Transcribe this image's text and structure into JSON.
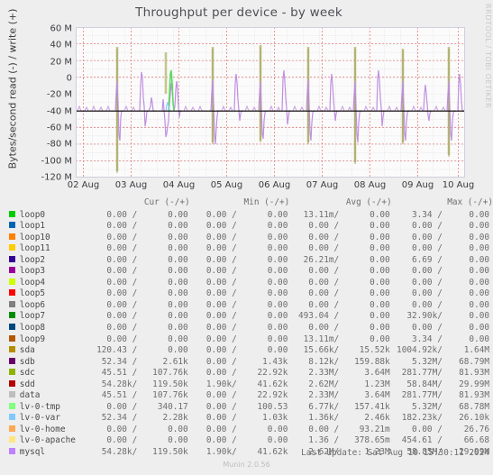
{
  "graph": {
    "title": "Throughput per device - by week",
    "ylabel": "Bytes/second read (-) / write (+)",
    "watermark": "RRDTOOL / TOBI OETIKER",
    "last_update": "Last update: Sat Aug 10 15:30:11 2024",
    "footer": "Munin 2.0.56"
  },
  "chart_data": {
    "type": "line",
    "title": "Throughput per device - by week",
    "xlabel": "",
    "ylabel": "Bytes/second read (-) / write (+)",
    "ylim": [
      -120000000,
      60000000
    ],
    "ytick_labels": [
      "60 M",
      "40 M",
      "20 M",
      "0",
      "-20 M",
      "-40 M",
      "-60 M",
      "-80 M",
      "-100 M",
      "-120 M"
    ],
    "ytick_values": [
      60000000,
      40000000,
      20000000,
      0,
      -20000000,
      -40000000,
      -60000000,
      -80000000,
      -100000000,
      -120000000
    ],
    "xtick_labels": [
      "02 Aug",
      "03 Aug",
      "04 Aug",
      "05 Aug",
      "06 Aug",
      "07 Aug",
      "08 Aug",
      "09 Aug",
      "10 Aug"
    ],
    "grid": true,
    "legend_position": "below",
    "series": [
      {
        "name": "loop0",
        "color": "#00cc00"
      },
      {
        "name": "loop1",
        "color": "#0066b3"
      },
      {
        "name": "loop10",
        "color": "#ff8000"
      },
      {
        "name": "loop11",
        "color": "#ffcc00"
      },
      {
        "name": "loop2",
        "color": "#330099"
      },
      {
        "name": "loop3",
        "color": "#990099"
      },
      {
        "name": "loop4",
        "color": "#ccff00"
      },
      {
        "name": "loop5",
        "color": "#ff0000"
      },
      {
        "name": "loop6",
        "color": "#808080"
      },
      {
        "name": "loop7",
        "color": "#008f00"
      },
      {
        "name": "loop8",
        "color": "#00487d"
      },
      {
        "name": "loop9",
        "color": "#b35a00"
      },
      {
        "name": "sda",
        "color": "#b38f00"
      },
      {
        "name": "sdb",
        "color": "#6b006b"
      },
      {
        "name": "sdc",
        "color": "#8fb300"
      },
      {
        "name": "sdd",
        "color": "#b30000"
      },
      {
        "name": "data",
        "color": "#bebebe"
      },
      {
        "name": "lv-0-tmp",
        "color": "#80ff80"
      },
      {
        "name": "lv-0-var",
        "color": "#80c9ff"
      },
      {
        "name": "lv-0-home",
        "color": "#ffa854"
      },
      {
        "name": "lv-0-apache",
        "color": "#ffe680"
      },
      {
        "name": "mysql",
        "color": "#bf7fff"
      }
    ]
  },
  "legend": {
    "columns": [
      "Cur (-/+)",
      "Min (-/+)",
      "Avg (-/+)",
      "Max (-/+)"
    ],
    "rows": [
      {
        "name": "loop0",
        "color": "#00cc00",
        "cur_neg": "0.00 /",
        "cur_pos": "0.00",
        "min_neg": "0.00 /",
        "min_pos": "0.00",
        "avg_neg": "13.11m/",
        "avg_pos": "0.00",
        "max_neg": "3.34 /",
        "max_pos": "0.00"
      },
      {
        "name": "loop1",
        "color": "#0066b3",
        "cur_neg": "0.00 /",
        "cur_pos": "0.00",
        "min_neg": "0.00 /",
        "min_pos": "0.00",
        "avg_neg": "0.00 /",
        "avg_pos": "0.00",
        "max_neg": "0.00 /",
        "max_pos": "0.00"
      },
      {
        "name": "loop10",
        "color": "#ff8000",
        "cur_neg": "0.00 /",
        "cur_pos": "0.00",
        "min_neg": "0.00 /",
        "min_pos": "0.00",
        "avg_neg": "0.00 /",
        "avg_pos": "0.00",
        "max_neg": "0.00 /",
        "max_pos": "0.00"
      },
      {
        "name": "loop11",
        "color": "#ffcc00",
        "cur_neg": "0.00 /",
        "cur_pos": "0.00",
        "min_neg": "0.00 /",
        "min_pos": "0.00",
        "avg_neg": "0.00 /",
        "avg_pos": "0.00",
        "max_neg": "0.00 /",
        "max_pos": "0.00"
      },
      {
        "name": "loop2",
        "color": "#330099",
        "cur_neg": "0.00 /",
        "cur_pos": "0.00",
        "min_neg": "0.00 /",
        "min_pos": "0.00",
        "avg_neg": "26.21m/",
        "avg_pos": "0.00",
        "max_neg": "6.69 /",
        "max_pos": "0.00"
      },
      {
        "name": "loop3",
        "color": "#990099",
        "cur_neg": "0.00 /",
        "cur_pos": "0.00",
        "min_neg": "0.00 /",
        "min_pos": "0.00",
        "avg_neg": "0.00 /",
        "avg_pos": "0.00",
        "max_neg": "0.00 /",
        "max_pos": "0.00"
      },
      {
        "name": "loop4",
        "color": "#ccff00",
        "cur_neg": "0.00 /",
        "cur_pos": "0.00",
        "min_neg": "0.00 /",
        "min_pos": "0.00",
        "avg_neg": "0.00 /",
        "avg_pos": "0.00",
        "max_neg": "0.00 /",
        "max_pos": "0.00"
      },
      {
        "name": "loop5",
        "color": "#ff0000",
        "cur_neg": "0.00 /",
        "cur_pos": "0.00",
        "min_neg": "0.00 /",
        "min_pos": "0.00",
        "avg_neg": "0.00 /",
        "avg_pos": "0.00",
        "max_neg": "0.00 /",
        "max_pos": "0.00"
      },
      {
        "name": "loop6",
        "color": "#808080",
        "cur_neg": "0.00 /",
        "cur_pos": "0.00",
        "min_neg": "0.00 /",
        "min_pos": "0.00",
        "avg_neg": "0.00 /",
        "avg_pos": "0.00",
        "max_neg": "0.00 /",
        "max_pos": "0.00"
      },
      {
        "name": "loop7",
        "color": "#008f00",
        "cur_neg": "0.00 /",
        "cur_pos": "0.00",
        "min_neg": "0.00 /",
        "min_pos": "0.00",
        "avg_neg": "493.04 /",
        "avg_pos": "0.00",
        "max_neg": "32.90k/",
        "max_pos": "0.00"
      },
      {
        "name": "loop8",
        "color": "#00487d",
        "cur_neg": "0.00 /",
        "cur_pos": "0.00",
        "min_neg": "0.00 /",
        "min_pos": "0.00",
        "avg_neg": "0.00 /",
        "avg_pos": "0.00",
        "max_neg": "0.00 /",
        "max_pos": "0.00"
      },
      {
        "name": "loop9",
        "color": "#b35a00",
        "cur_neg": "0.00 /",
        "cur_pos": "0.00",
        "min_neg": "0.00 /",
        "min_pos": "0.00",
        "avg_neg": "13.11m/",
        "avg_pos": "0.00",
        "max_neg": "3.34 /",
        "max_pos": "0.00"
      },
      {
        "name": "sda",
        "color": "#b38f00",
        "cur_neg": "120.43 /",
        "cur_pos": "0.00",
        "min_neg": "0.00 /",
        "min_pos": "0.00",
        "avg_neg": "15.66k/",
        "avg_pos": "15.52k",
        "max_neg": "1004.92k/",
        "max_pos": "1.64M"
      },
      {
        "name": "sdb",
        "color": "#6b006b",
        "cur_neg": "52.34 /",
        "cur_pos": "2.61k",
        "min_neg": "0.00 /",
        "min_pos": "1.43k",
        "avg_neg": "8.12k/",
        "avg_pos": "159.88k",
        "max_neg": "5.32M/",
        "max_pos": "68.79M"
      },
      {
        "name": "sdc",
        "color": "#8fb300",
        "cur_neg": "45.51 /",
        "cur_pos": "107.76k",
        "min_neg": "0.00 /",
        "min_pos": "22.92k",
        "avg_neg": "2.33M/",
        "avg_pos": "3.64M",
        "max_neg": "281.77M/",
        "max_pos": "81.93M"
      },
      {
        "name": "sdd",
        "color": "#b30000",
        "cur_neg": "54.28k/",
        "cur_pos": "119.50k",
        "min_neg": "1.90k/",
        "min_pos": "41.62k",
        "avg_neg": "2.62M/",
        "avg_pos": "1.23M",
        "max_neg": "58.84M/",
        "max_pos": "29.99M"
      },
      {
        "name": "data",
        "color": "#bebebe",
        "cur_neg": "45.51 /",
        "cur_pos": "107.76k",
        "min_neg": "0.00 /",
        "min_pos": "22.92k",
        "avg_neg": "2.33M/",
        "avg_pos": "3.64M",
        "max_neg": "281.77M/",
        "max_pos": "81.93M"
      },
      {
        "name": "lv-0-tmp",
        "color": "#80ff80",
        "cur_neg": "0.00 /",
        "cur_pos": "340.17",
        "min_neg": "0.00 /",
        "min_pos": "100.53",
        "avg_neg": "6.77k/",
        "avg_pos": "157.41k",
        "max_neg": "5.32M/",
        "max_pos": "68.78M"
      },
      {
        "name": "lv-0-var",
        "color": "#80c9ff",
        "cur_neg": "52.34 /",
        "cur_pos": "2.28k",
        "min_neg": "0.00 /",
        "min_pos": "1.03k",
        "avg_neg": "1.36k/",
        "avg_pos": "2.46k",
        "max_neg": "182.23k/",
        "max_pos": "26.10k"
      },
      {
        "name": "lv-0-home",
        "color": "#ffa854",
        "cur_neg": "0.00 /",
        "cur_pos": "0.00",
        "min_neg": "0.00 /",
        "min_pos": "0.00",
        "avg_neg": "0.00 /",
        "avg_pos": "93.21m",
        "max_neg": "0.00 /",
        "max_pos": "26.76"
      },
      {
        "name": "lv-0-apache",
        "color": "#ffe680",
        "cur_neg": "0.00 /",
        "cur_pos": "0.00",
        "min_neg": "0.00 /",
        "min_pos": "0.00",
        "avg_neg": "1.36 /",
        "avg_pos": "378.65m",
        "max_neg": "454.61 /",
        "max_pos": "66.68"
      },
      {
        "name": "mysql",
        "color": "#bf7fff",
        "cur_neg": "54.28k/",
        "cur_pos": "119.50k",
        "min_neg": "1.90k/",
        "min_pos": "41.62k",
        "avg_neg": "2.62M/",
        "avg_pos": "1.23M",
        "max_neg": "58.85M/",
        "max_pos": "29.99M"
      }
    ]
  }
}
